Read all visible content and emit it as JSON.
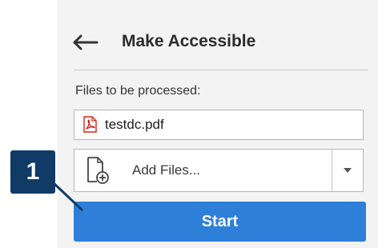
{
  "panel": {
    "title": "Make Accessible",
    "back_icon": "arrow-left-icon"
  },
  "files": {
    "label": "Files to be processed:",
    "items": [
      {
        "name": "testdc.pdf",
        "icon": "pdf-file-icon"
      }
    ]
  },
  "add_files": {
    "label": "Add Files...",
    "icon": "add-file-icon",
    "dropdown_icon": "caret-down-icon"
  },
  "start": {
    "label": "Start"
  },
  "callout": {
    "number": "1"
  },
  "colors": {
    "accent": "#2d7fd8",
    "callout": "#0f3b66",
    "pdf_red": "#d9241c",
    "panel_bg": "#f3f3f3"
  }
}
